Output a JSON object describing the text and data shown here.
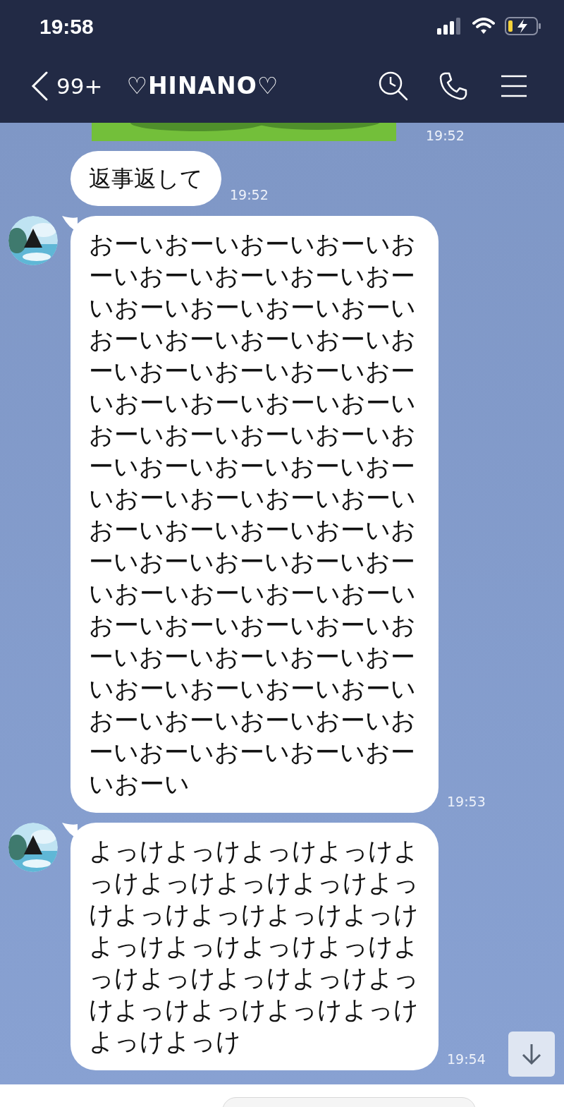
{
  "status_bar": {
    "time": "19:58"
  },
  "header": {
    "unread_count": "99+",
    "title": "♡HINANO♡"
  },
  "messages": [
    {
      "kind": "sticker",
      "time": "19:52"
    },
    {
      "kind": "text",
      "show_avatar": false,
      "text": "返事返して",
      "time": "19:52"
    },
    {
      "kind": "text",
      "show_avatar": true,
      "text": "おーいおーいおーいおーいおーいおーいおーいおーいおーいおーいおーいおーいおーいおーいおーいおーいおーいおーいおーいおーいおーいおーいおーいおーいおーいおーいおーいおーいおーいおーいおーいおーいおーいおーいおーいおーいおーいおーいおーいおーいおーいおーいおーいおーいおーいおーいおーいおーいおーいおーいおーいおーいおーいおーいおーいおーいおーいおーいおーいおーいおーいおーいおーいおーいおーいおーいおーいおーいおーいおーいおーいおーいおーいおーいおーい",
      "time": "19:53"
    },
    {
      "kind": "text",
      "show_avatar": true,
      "text": "よっけよっけよっけよっけよっけよっけよっけよっけよっけよっけよっけよっけよっけよっけよっけよっけよっけよっけよっけよっけよっけよっけよっけよっけよっけよっけよっけよっけ",
      "time": "19:54"
    }
  ]
}
